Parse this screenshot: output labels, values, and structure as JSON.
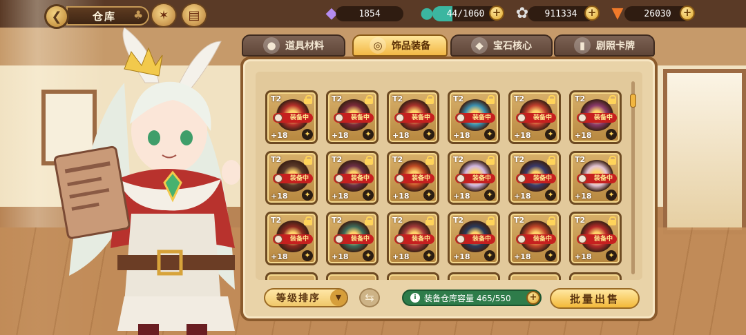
{
  "header": {
    "title": "仓库"
  },
  "resources": [
    {
      "name": "crystal",
      "icon": "gem-icon",
      "value": "1854",
      "has_plus": false
    },
    {
      "name": "stamina",
      "icon": "potion-icon",
      "value": "44/1060",
      "has_plus": true
    },
    {
      "name": "coins",
      "icon": "coin-icon",
      "value": "911334",
      "has_plus": true
    },
    {
      "name": "carrots",
      "icon": "carrot-icon",
      "value": "26030",
      "has_plus": true
    }
  ],
  "tabs": [
    {
      "label": "道具材料",
      "icon": "bag-icon",
      "active": false
    },
    {
      "label": "饰品装备",
      "icon": "ring-icon",
      "active": true
    },
    {
      "label": "宝石核心",
      "icon": "gem-core-icon",
      "active": false
    },
    {
      "label": "剧照卡牌",
      "icon": "card-icon",
      "active": false
    }
  ],
  "items": [
    {
      "tier": "T2",
      "level": "+18",
      "equipped": true,
      "locked": true,
      "color": "#b5302a"
    },
    {
      "tier": "T2",
      "level": "+18",
      "equipped": true,
      "locked": true,
      "color": "#7a2a3a"
    },
    {
      "tier": "T2",
      "level": "+18",
      "equipped": true,
      "locked": true,
      "color": "#a8322c"
    },
    {
      "tier": "T2",
      "level": "+18",
      "equipped": true,
      "locked": true,
      "color": "#3b8fb0"
    },
    {
      "tier": "T2",
      "level": "+18",
      "equipped": true,
      "locked": true,
      "color": "#c0402f"
    },
    {
      "tier": "T2",
      "level": "+18",
      "equipped": true,
      "locked": true,
      "color": "#8a3a6a"
    },
    {
      "tier": "T2",
      "level": "+18",
      "equipped": true,
      "locked": true,
      "color": "#5b3a2a"
    },
    {
      "tier": "T2",
      "level": "+18",
      "equipped": true,
      "locked": true,
      "color": "#6b2f45"
    },
    {
      "tier": "T2",
      "level": "+18",
      "equipped": true,
      "locked": true,
      "color": "#c04a25"
    },
    {
      "tier": "T2",
      "level": "+18",
      "equipped": true,
      "locked": true,
      "color": "#d0b6e0"
    },
    {
      "tier": "T2",
      "level": "+18",
      "equipped": true,
      "locked": true,
      "color": "#3a3a6a"
    },
    {
      "tier": "T2",
      "level": "+18",
      "equipped": true,
      "locked": true,
      "color": "#e3c3d3"
    },
    {
      "tier": "T2",
      "level": "+18",
      "equipped": true,
      "locked": true,
      "color": "#8a2a20"
    },
    {
      "tier": "T2",
      "level": "+18",
      "equipped": true,
      "locked": true,
      "color": "#3d6a5a"
    },
    {
      "tier": "T2",
      "level": "+18",
      "equipped": true,
      "locked": true,
      "color": "#a33a3a"
    },
    {
      "tier": "T2",
      "level": "+18",
      "equipped": true,
      "locked": true,
      "color": "#2a3a5a"
    },
    {
      "tier": "T2",
      "level": "+18",
      "equipped": true,
      "locked": true,
      "color": "#c2452a"
    },
    {
      "tier": "T2",
      "level": "+18",
      "equipped": true,
      "locked": true,
      "color": "#b52a2a"
    }
  ],
  "equip_label": "装备中",
  "controls": {
    "sort_label": "等级排序",
    "capacity_label": "装备仓库容量 465/550",
    "sell_label": "批量出售"
  }
}
